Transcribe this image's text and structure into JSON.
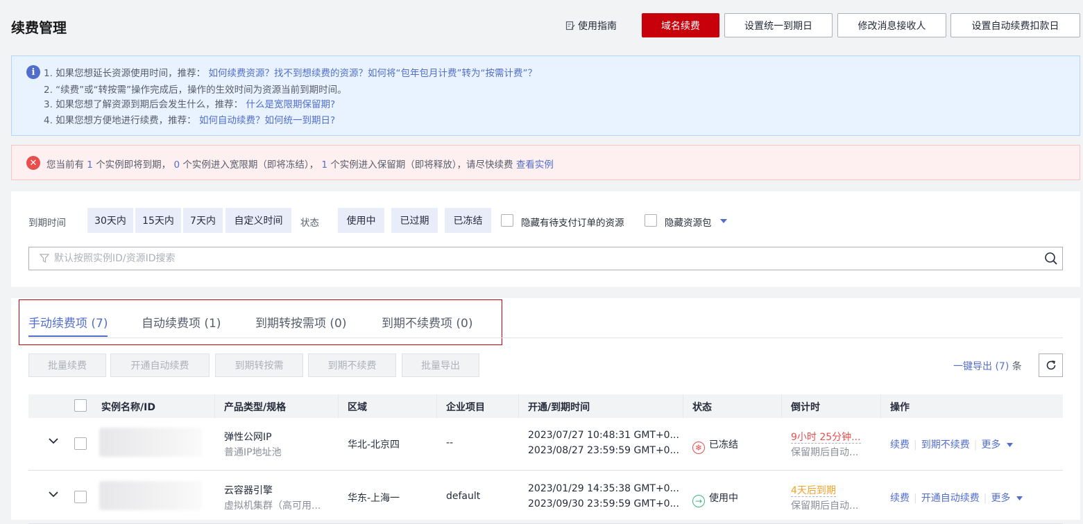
{
  "header": {
    "title": "续费管理",
    "guide_label": "使用指南",
    "buttons": {
      "domain_renew": "域名续费",
      "unify_expiry": "设置统一到期日",
      "modify_receiver": "修改消息接收人",
      "auto_renew_date": "设置自动续费扣款日"
    }
  },
  "info": {
    "l1_text": "1. 如果您想延长资源使用时间，推荐：",
    "l1_links": "如何续费资源？找不到想续费的资源？如何将“包年包月计费”转为“按需计费”？",
    "l2_text": "2. “续费”或“转按需”操作完成后，操作的生效时间为资源当前到期时间。",
    "l3_text": "3. 如果您想了解资源到期后会发生什么，推荐：",
    "l3_links": "什么是宽限期保留期?",
    "l4_text": "4. 如果您想方便地进行续费，推荐：",
    "l4_links": "如何自动续费？如何统一到期日?"
  },
  "alert": {
    "p1": "您当前有",
    "n1": "1",
    "p2": "个实例即将到期，",
    "n2": "0",
    "p3": "个实例进入宽限期（即将冻结），",
    "n3": "1",
    "p4": "个实例进入保留期（即将释放），请尽快续费",
    "link": "查看实例"
  },
  "filters": {
    "expiry_label": "到期时间",
    "expiry_options": [
      "30天内",
      "15天内",
      "7天内",
      "自定义时间"
    ],
    "status_label": "状态",
    "status_options": [
      "使用中",
      "已过期",
      "已冻结"
    ],
    "hide_pending": "隐藏有待支付订单的资源",
    "hide_package": "隐藏资源包",
    "search_placeholder": "默认按照实例ID/资源ID搜索"
  },
  "tabs": [
    {
      "label": "手动续费项 (7)",
      "active": true
    },
    {
      "label": "自动续费项 (1)",
      "active": false
    },
    {
      "label": "到期转按需项 (0)",
      "active": false
    },
    {
      "label": "到期不续费项 (0)",
      "active": false
    }
  ],
  "actions": {
    "batch_renew": "批量续费",
    "enable_auto": "开通自动续费",
    "to_ondemand": "到期转按需",
    "no_renew": "到期不续费",
    "batch_export": "批量导出",
    "export_label": "一键导出",
    "export_count": "(7)",
    "export_unit": "条"
  },
  "table": {
    "columns": [
      "实例名称/ID",
      "产品类型/规格",
      "区域",
      "企业项目",
      "开通/到期时间",
      "状态",
      "倒计时",
      "操作"
    ],
    "rows": [
      {
        "product": "弹性公网IP",
        "spec": "普通IP地址池",
        "region": "华北-北京四",
        "project": "--",
        "start": "2023/07/27 10:48:31 GMT+0...",
        "end": "2023/08/27 23:59:59 GMT+0...",
        "status": "已冻结",
        "countdown": "9小时 25分钟...",
        "countdown_sub": "保留期后自动...",
        "ops": [
          "续费",
          "到期不续费",
          "更多"
        ]
      },
      {
        "product": "云容器引擎",
        "spec": "虚拟机集群（高可用...",
        "region": "华东-上海一",
        "project": "default",
        "start": "2023/01/29 14:35:38 GMT+0...",
        "end": "2023/09/30 23:59:59 GMT+0...",
        "status": "使用中",
        "countdown": "4天后到期",
        "countdown_sub": "保留期后自动...",
        "ops": [
          "续费",
          "开通自动续费",
          "更多"
        ]
      }
    ]
  },
  "colors": {
    "brand_red": "#c7000b",
    "link_blue": "#526ecc",
    "danger": "#e84e4e",
    "success": "#3fb67a",
    "warning": "#f2a127"
  }
}
